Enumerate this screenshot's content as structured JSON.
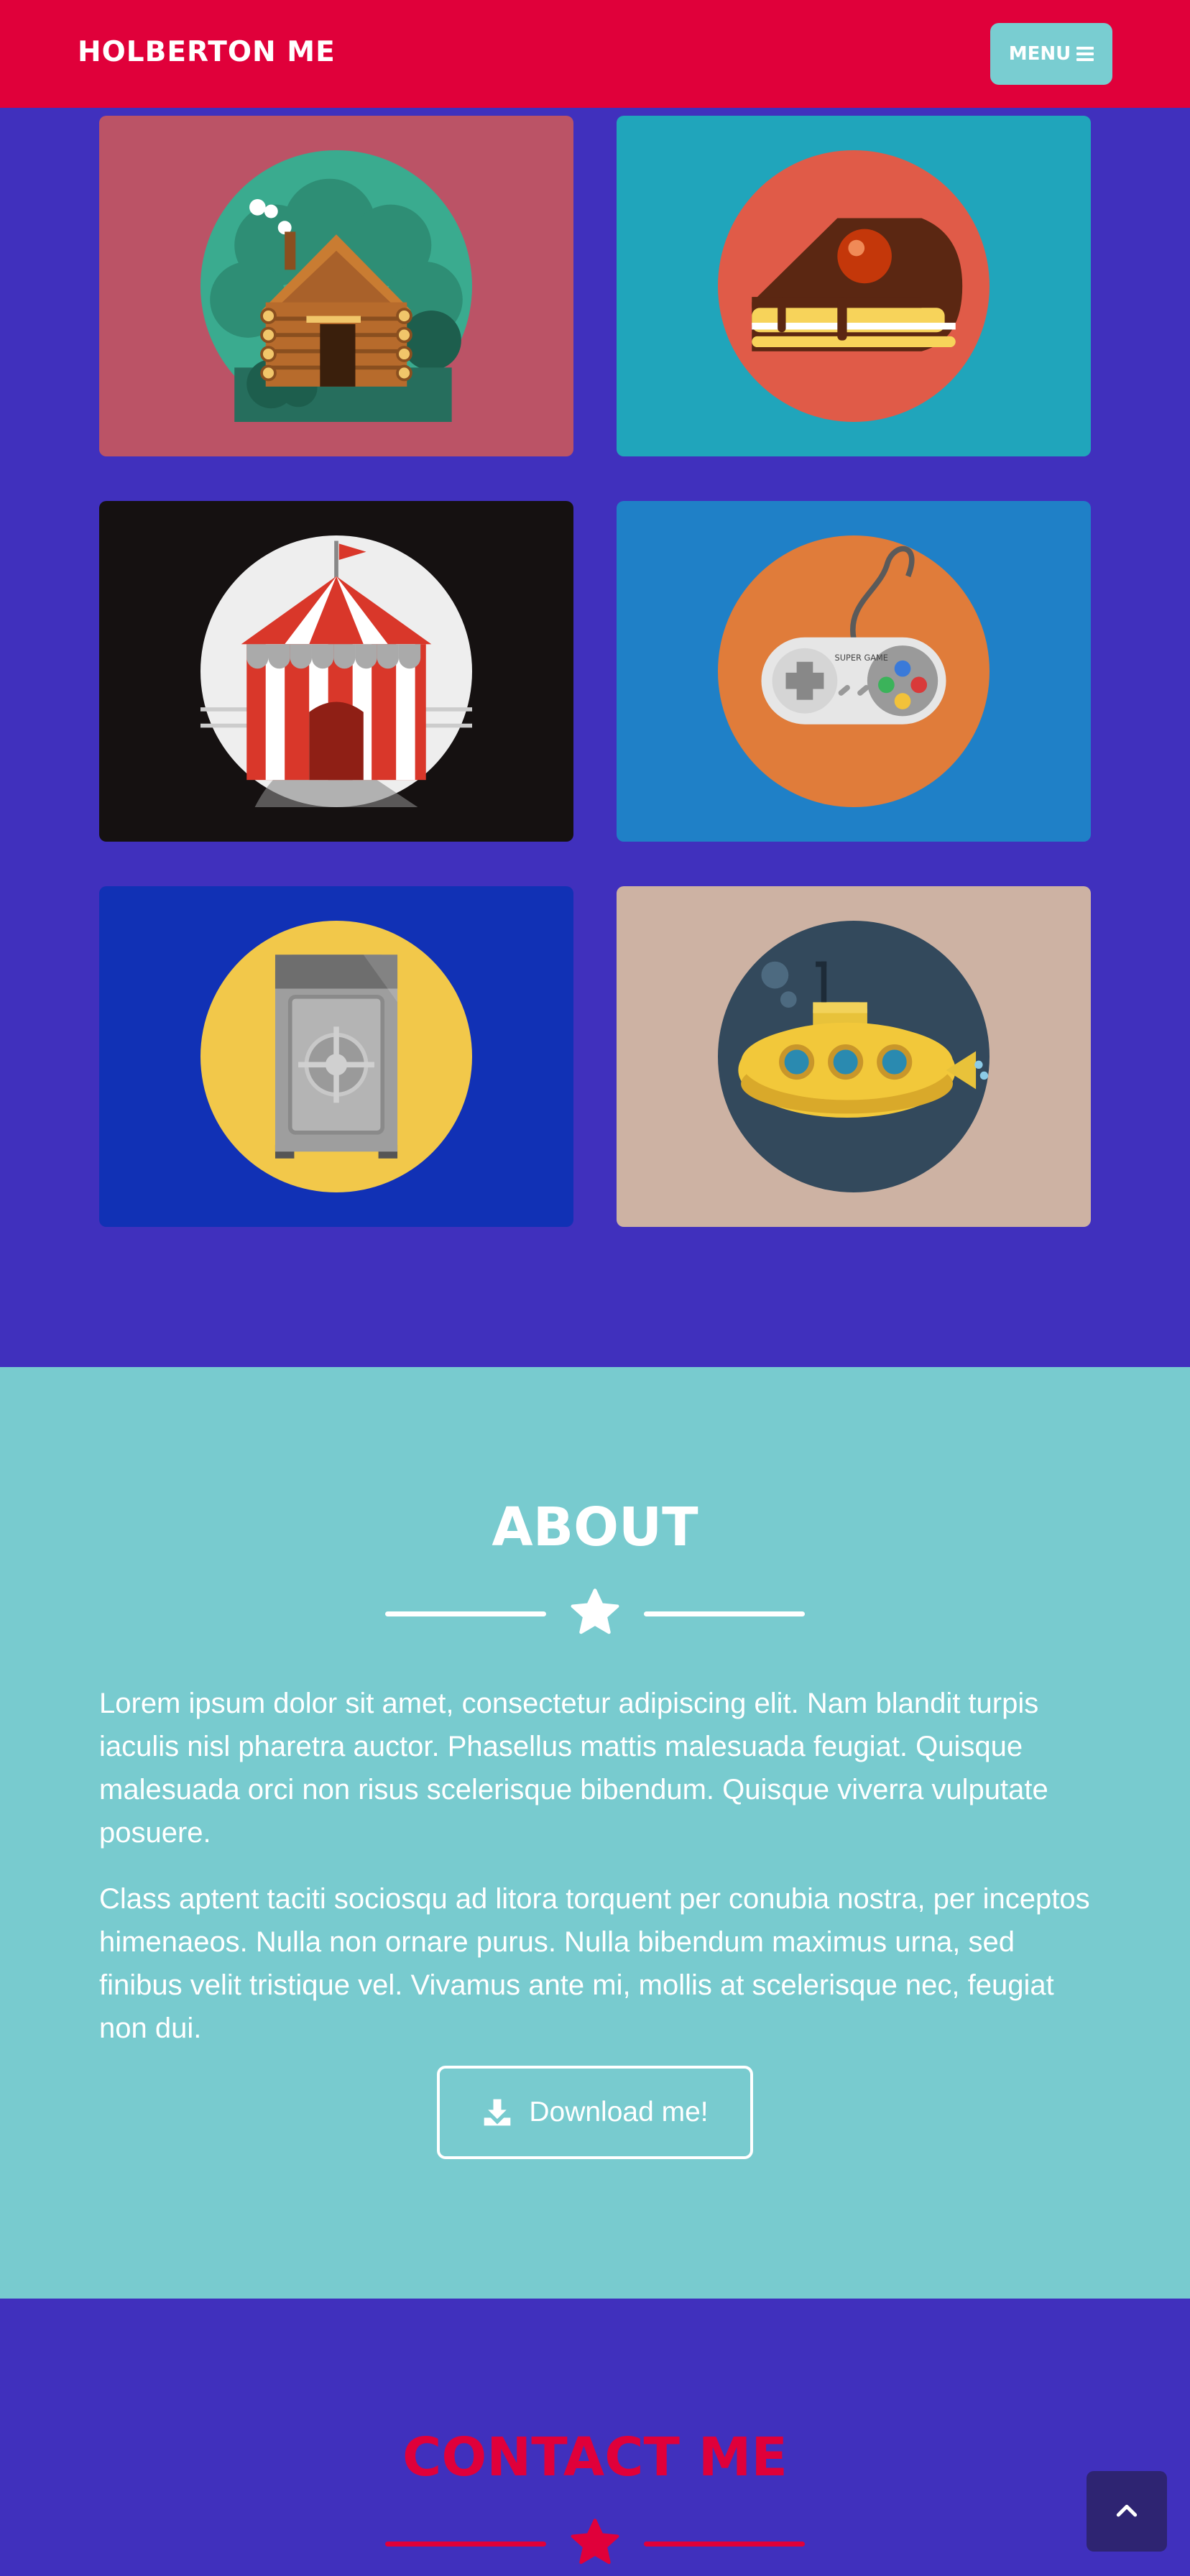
{
  "navbar": {
    "brand": "HOLBERTON ME",
    "menu_label": "MENU",
    "menu_icon": "hamburger-icon",
    "color": "#e0003a"
  },
  "portfolio": {
    "items": [
      {
        "name": "cabin",
        "bg": "#bb5366"
      },
      {
        "name": "cake",
        "bg": "#20a5bb"
      },
      {
        "name": "circus",
        "bg": "#151111"
      },
      {
        "name": "game-controller",
        "bg": "#1f80c7",
        "controller_text": "SUPER GAME"
      },
      {
        "name": "safe",
        "bg": "#1131b5"
      },
      {
        "name": "submarine",
        "bg": "#cdb2a3"
      }
    ]
  },
  "about": {
    "title": "ABOUT",
    "paragraph1": "Lorem ipsum dolor sit amet, consectetur adipiscing elit. Nam blandit turpis iaculis nisl pharetra auctor. Phasellus mattis malesuada feugiat. Quisque malesuada orci non risus scelerisque bibendum. Quisque viverra vulputate posuere.",
    "paragraph2": "Class aptent taciti sociosqu ad litora torquent per conubia nostra, per inceptos himenaeos. Nulla non ornare purus. Nulla bibendum maximus urna, sed finibus velit tristique vel. Vivamus ante mi, mollis at scelerisque nec, feugiat non dui.",
    "download_label": "Download me!",
    "download_icon": "download-icon",
    "bg": "#78cbcf"
  },
  "contact": {
    "title": "CONTACT ME",
    "accent": "#e0003a"
  },
  "scroll_top": {
    "icon": "chevron-up-icon"
  }
}
